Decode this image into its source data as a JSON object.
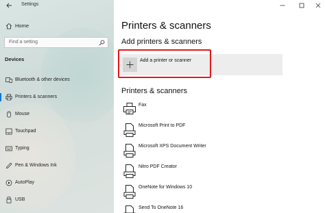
{
  "window": {
    "title": "Settings"
  },
  "sidebar": {
    "home_label": "Home",
    "search_placeholder": "Find a setting",
    "section_header": "Devices",
    "items": [
      {
        "label": "Bluetooth & other devices",
        "icon": "bluetooth-devices-icon",
        "selected": false
      },
      {
        "label": "Printers & scanners",
        "icon": "printer-icon",
        "selected": true
      },
      {
        "label": "Mouse",
        "icon": "mouse-icon",
        "selected": false
      },
      {
        "label": "Touchpad",
        "icon": "touchpad-icon",
        "selected": false
      },
      {
        "label": "Typing",
        "icon": "keyboard-icon",
        "selected": false
      },
      {
        "label": "Pen & Windows Ink",
        "icon": "pen-icon",
        "selected": false
      },
      {
        "label": "AutoPlay",
        "icon": "autoplay-icon",
        "selected": false
      },
      {
        "label": "USB",
        "icon": "usb-icon",
        "selected": false
      }
    ]
  },
  "main": {
    "page_title": "Printers & scanners",
    "add_section_title": "Add printers & scanners",
    "add_button_label": "Add a printer or scanner",
    "list_title": "Printers & scanners",
    "devices": [
      {
        "label": "Fax",
        "icon": "fax-icon"
      },
      {
        "label": "Microsoft Print to PDF",
        "icon": "virtual-printer-icon"
      },
      {
        "label": "Microsoft XPS Document Writer",
        "icon": "virtual-printer-icon"
      },
      {
        "label": "Nitro PDF Creator",
        "icon": "virtual-printer-icon"
      },
      {
        "label": "OneNote for Windows 10",
        "icon": "virtual-printer-icon"
      },
      {
        "label": "Send To OneNote 16",
        "icon": "virtual-printer-icon"
      }
    ]
  },
  "colors": {
    "accent": "#0078d7",
    "highlight_box": "#e01919"
  }
}
